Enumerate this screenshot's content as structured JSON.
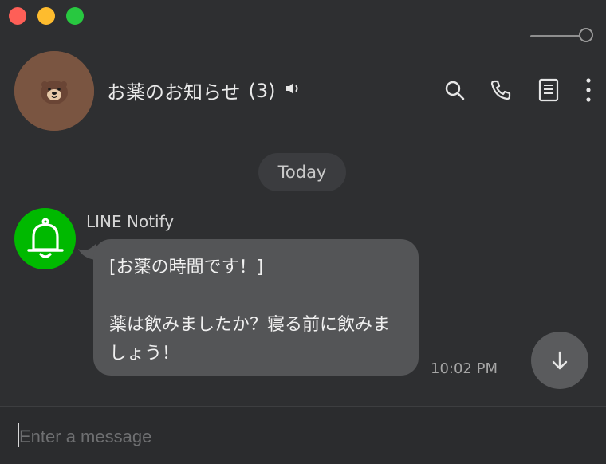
{
  "window": {
    "controls": [
      "close",
      "minimize",
      "zoom"
    ]
  },
  "header": {
    "chat_title": "お薬のお知らせ",
    "member_count": "(3)",
    "icons": [
      "speaker-icon",
      "search-icon",
      "phone-icon",
      "notes-icon",
      "more-vertical-icon"
    ]
  },
  "chat": {
    "date_label": "Today",
    "messages": [
      {
        "sender": "LINE Notify",
        "text": "[お薬の時間です！]\n\n薬は飲みましたか？寝る前に飲みましょう！",
        "time": "10:02 PM"
      }
    ]
  },
  "composer": {
    "placeholder": "Enter a message",
    "value": ""
  },
  "colors": {
    "background": "#2e2f31",
    "bubble": "#545557",
    "line_green": "#00b900",
    "avatar_brown": "#7a5541"
  }
}
